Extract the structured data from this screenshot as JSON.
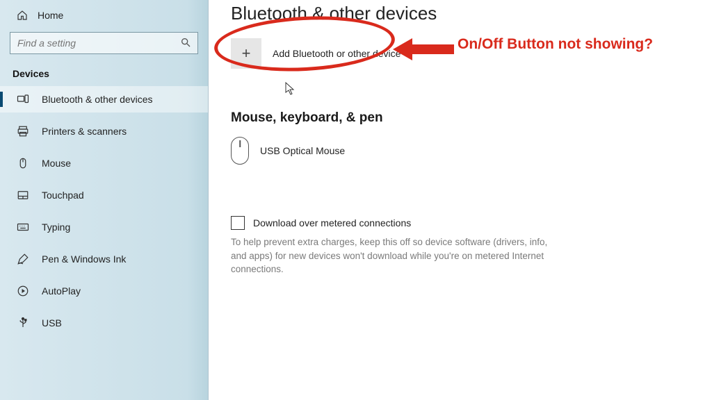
{
  "sidebar": {
    "home_label": "Home",
    "search_placeholder": "Find a setting",
    "section_label": "Devices",
    "items": [
      {
        "label": "Bluetooth & other devices",
        "icon": "devices",
        "active": true
      },
      {
        "label": "Printers & scanners",
        "icon": "printer"
      },
      {
        "label": "Mouse",
        "icon": "mouse"
      },
      {
        "label": "Touchpad",
        "icon": "touchpad"
      },
      {
        "label": "Typing",
        "icon": "typing"
      },
      {
        "label": "Pen & Windows Ink",
        "icon": "pen"
      },
      {
        "label": "AutoPlay",
        "icon": "autoplay"
      },
      {
        "label": "USB",
        "icon": "usb"
      }
    ]
  },
  "main": {
    "title": "Bluetooth & other devices",
    "add_label": "Add Bluetooth or other device",
    "group_title": "Mouse, keyboard, & pen",
    "devices": [
      {
        "name": "USB Optical Mouse"
      }
    ],
    "metered_label": "Download over metered connections",
    "metered_help": "To help prevent extra charges, keep this off so device software (drivers, info, and apps) for new devices won't download while you're on metered Internet connections."
  },
  "annotation": {
    "text": "On/Off Button not showing?",
    "color": "#d92a1c"
  }
}
